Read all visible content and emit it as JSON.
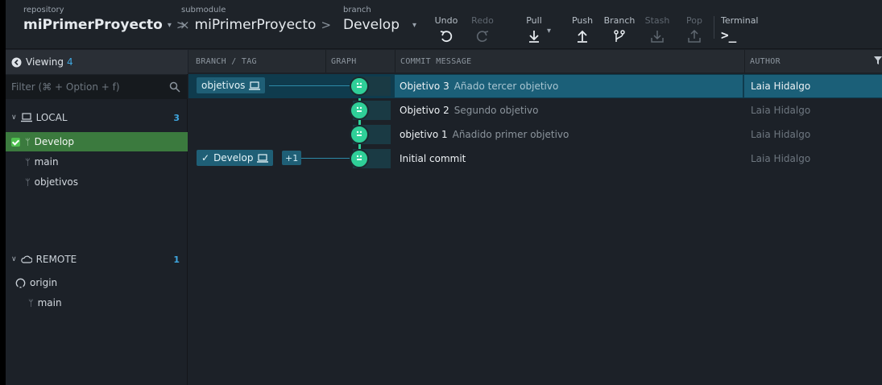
{
  "toolbar": {
    "repository_label": "repository",
    "repository_name": "miPrimerProyecto",
    "submodule_label": "submodule",
    "submodule_name": "miPrimerProyecto",
    "branch_label": "branch",
    "branch_name": "Develop",
    "separator": ">",
    "close_symbol": "×",
    "actions": [
      {
        "label": "Undo",
        "icon": "undo-icon",
        "enabled": true
      },
      {
        "label": "Redo",
        "icon": "redo-icon",
        "enabled": false
      },
      {
        "label": "Pull",
        "icon": "pull-icon",
        "enabled": true
      },
      {
        "label": "Push",
        "icon": "push-icon",
        "enabled": true
      },
      {
        "label": "Branch",
        "icon": "branch-icon",
        "enabled": true
      },
      {
        "label": "Stash",
        "icon": "stash-icon",
        "enabled": false
      },
      {
        "label": "Pop",
        "icon": "pop-icon",
        "enabled": false
      }
    ],
    "terminal_label": "Terminal",
    "terminal_glyph": ">_"
  },
  "left_panel": {
    "viewing_label": "Viewing",
    "viewing_count": "4",
    "filter_placeholder": "Filter (⌘ + Option + f)",
    "local": {
      "label": "LOCAL",
      "count": "3",
      "branches": [
        {
          "name": "Develop",
          "active": true
        },
        {
          "name": "main",
          "active": false
        },
        {
          "name": "objetivos",
          "active": false
        }
      ]
    },
    "remote": {
      "label": "REMOTE",
      "count": "1",
      "remote_name": "origin",
      "branches": [
        {
          "name": "main"
        }
      ]
    }
  },
  "graph": {
    "headers": {
      "branch_tag": "BRANCH / TAG",
      "graph": "GRAPH",
      "commit_message": "COMMIT MESSAGE",
      "author": "AUTHOR"
    },
    "commits": [
      {
        "title": "Objetivo 3",
        "message": "Añado tercer objetivo",
        "author": "Laia Hidalgo",
        "branch": "objetivos"
      },
      {
        "title": "Objetivo 2",
        "message": "Segundo objetivo",
        "author": "Laia Hidalgo",
        "branch": ""
      },
      {
        "title": "objetivo 1",
        "message": "Añadido primer objetivo",
        "author": "Laia Hidalgo",
        "branch": ""
      },
      {
        "title": "Initial commit",
        "message": "",
        "author": "Laia Hidalgo",
        "branch": "Develop"
      }
    ],
    "develop_tag_check": "✓",
    "develop_extra": "+1"
  },
  "colors": {
    "accent_teal": "#2fcf98",
    "selected_row": "#1b5f78",
    "active_branch": "#3b7a3e",
    "count_blue": "#3fa7e0"
  }
}
